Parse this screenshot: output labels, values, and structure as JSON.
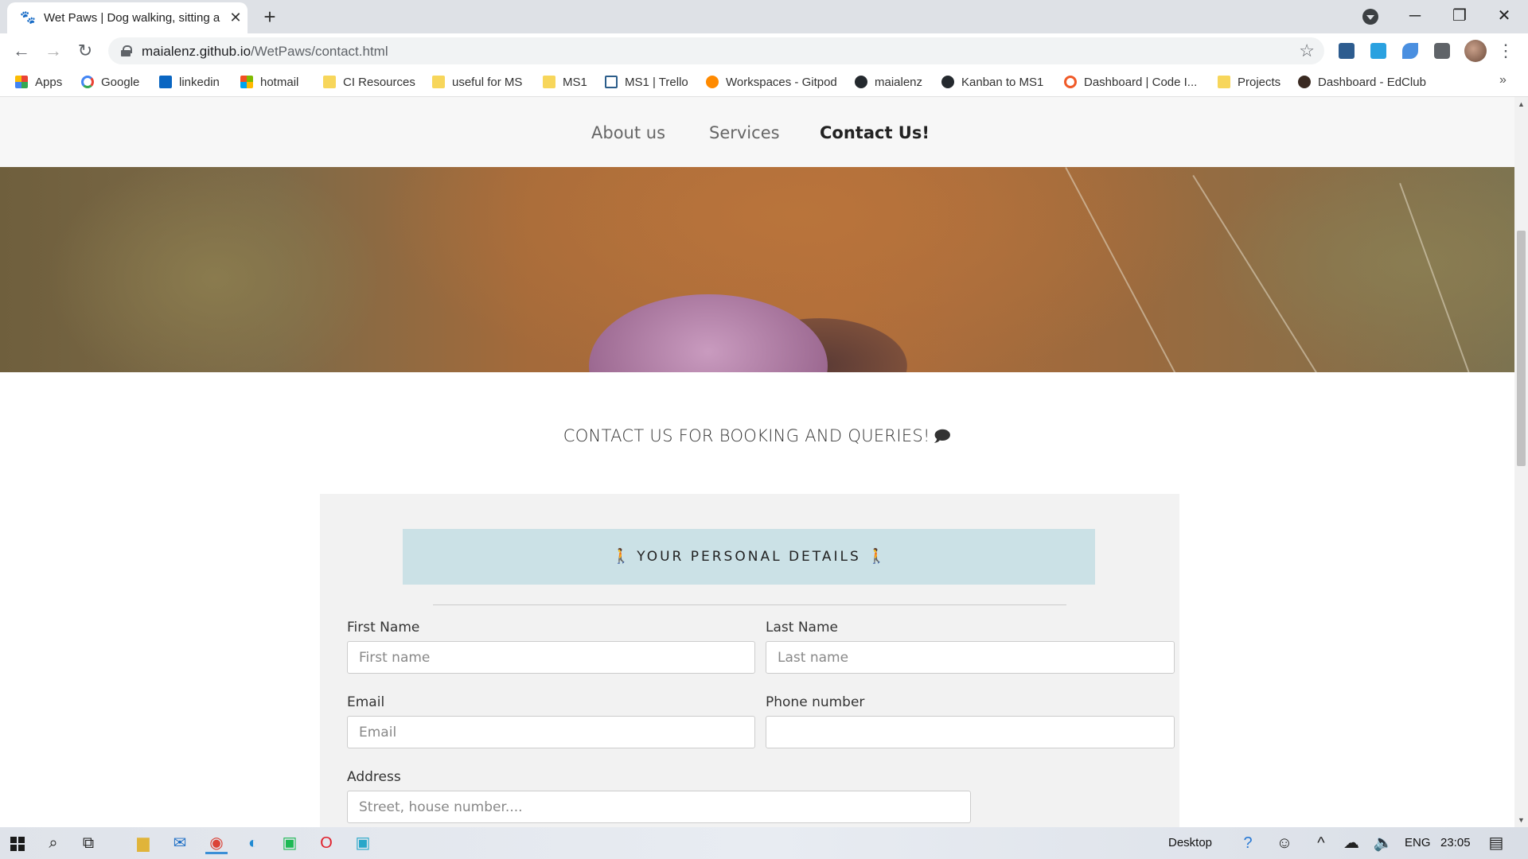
{
  "browser": {
    "tab": {
      "title": "Wet Paws | Dog walking, sitting a",
      "favicon": "paw-icon"
    },
    "url": {
      "host": "maialenz.github.io",
      "path": "/WetPaws/contact.html"
    },
    "bookmarks": [
      {
        "label": "Apps",
        "icon": "apps-grid-icon"
      },
      {
        "label": "Google",
        "icon": "google-icon"
      },
      {
        "label": "linkedin",
        "icon": "linkedin-icon"
      },
      {
        "label": "hotmail",
        "icon": "microsoft-icon"
      },
      {
        "label": "CI Resources",
        "icon": "folder-icon"
      },
      {
        "label": "useful for MS",
        "icon": "folder-icon"
      },
      {
        "label": "MS1",
        "icon": "folder-icon"
      },
      {
        "label": "MS1 | Trello",
        "icon": "trello-icon"
      },
      {
        "label": "Workspaces - Gitpod",
        "icon": "gitpod-icon"
      },
      {
        "label": "maialenz",
        "icon": "github-icon"
      },
      {
        "label": "Kanban to MS1",
        "icon": "github-icon"
      },
      {
        "label": "Dashboard | Code I...",
        "icon": "codeinstitute-icon"
      },
      {
        "label": "Projects",
        "icon": "folder-icon"
      },
      {
        "label": "Dashboard - EdClub",
        "icon": "edclub-icon"
      }
    ]
  },
  "site": {
    "nav": {
      "about": "About us",
      "services": "Services",
      "contact": "Contact Us!"
    },
    "heading": "CONTACT US FOR BOOKING AND QUERIES!",
    "form": {
      "section_title": "YOUR PERSONAL DETAILS",
      "first_name": {
        "label": "First Name",
        "placeholder": "First name"
      },
      "last_name": {
        "label": "Last Name",
        "placeholder": "Last name"
      },
      "email": {
        "label": "Email",
        "placeholder": "Email"
      },
      "phone": {
        "label": "Phone number",
        "placeholder": ""
      },
      "address": {
        "label": "Address",
        "placeholder": "Street, house number...."
      }
    }
  },
  "taskbar": {
    "desktop_label": "Desktop",
    "language": "ENG",
    "time": "23:05"
  },
  "colors": {
    "banner": "#cbe1e6",
    "panel": "#f2f2f2",
    "nav_bg": "#f7f7f7"
  }
}
